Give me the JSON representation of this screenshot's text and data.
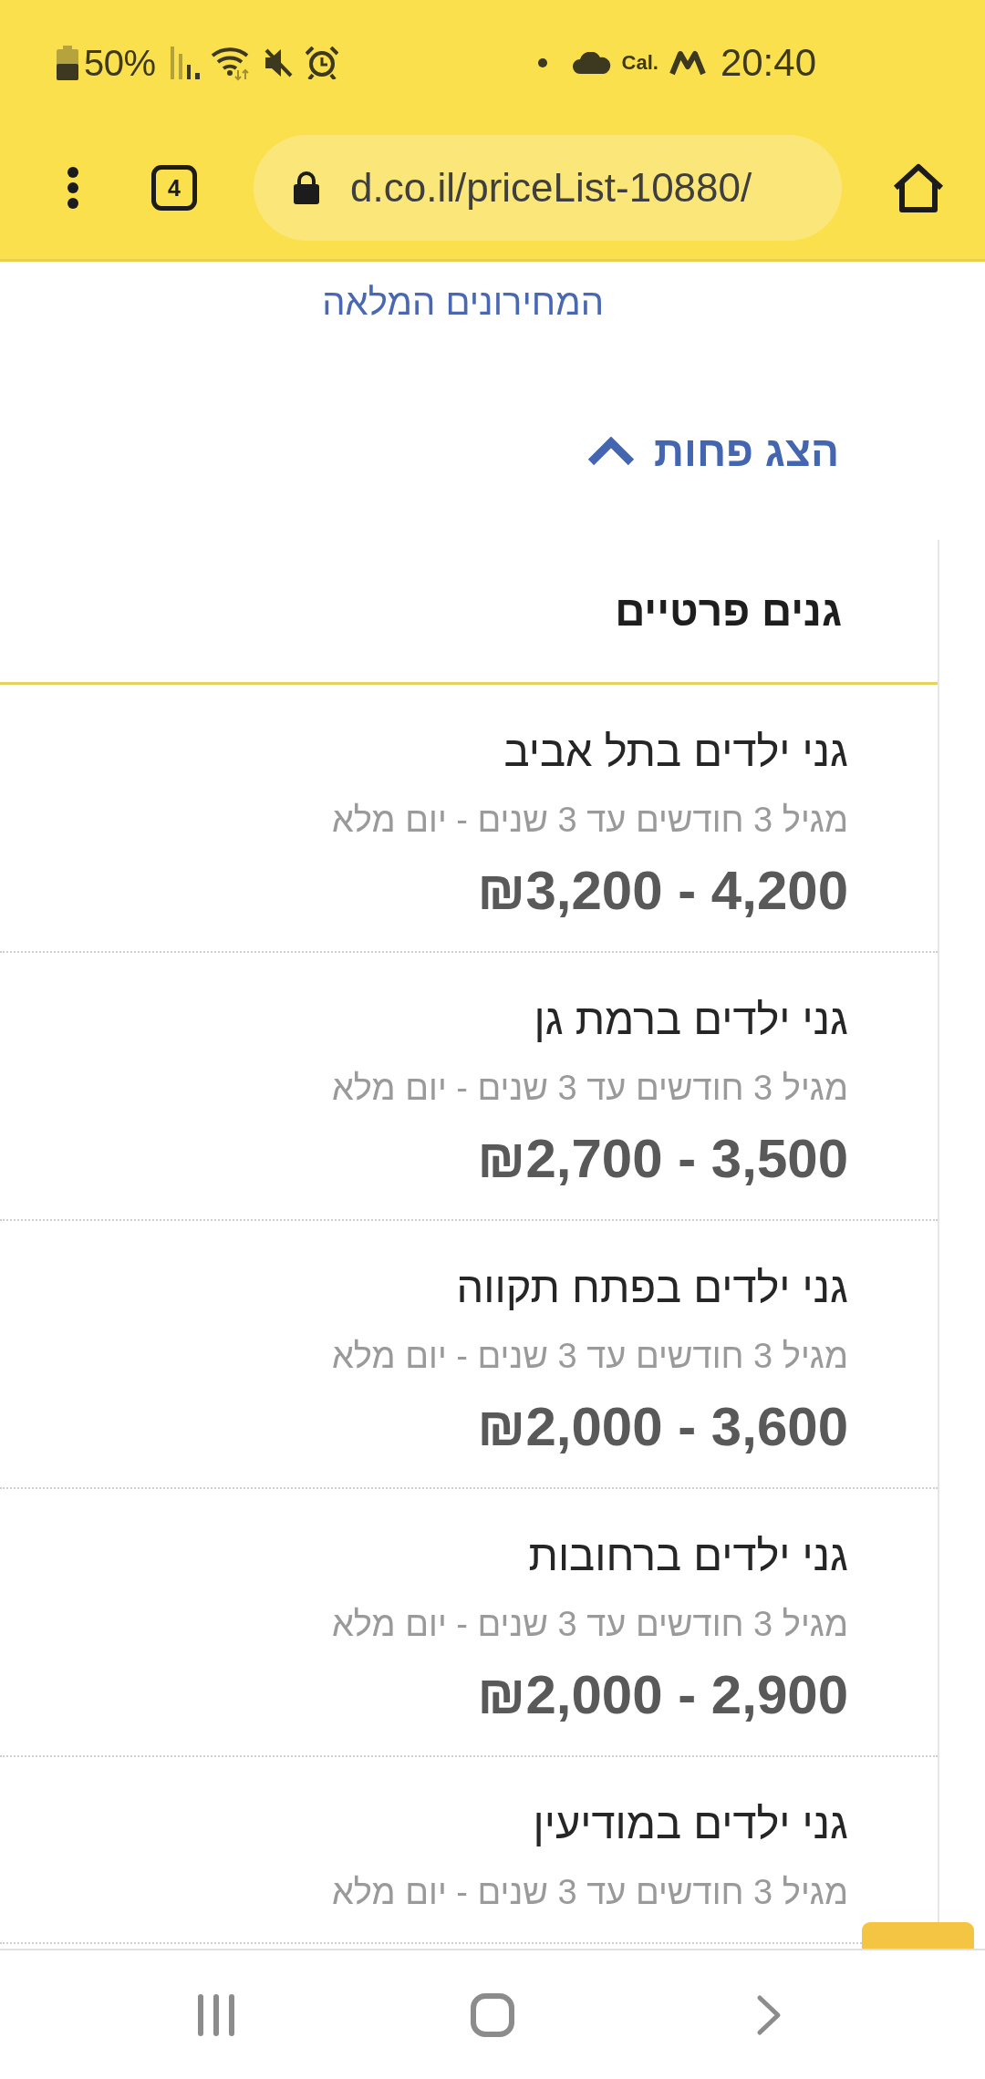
{
  "status_bar": {
    "battery": "50%",
    "notification_label": "Cal.",
    "time": "20:40"
  },
  "browser_toolbar": {
    "tab_count": "4",
    "url": "d.co.il/priceList-10880/"
  },
  "page": {
    "link": "המחירונים המלאה",
    "toggle": {
      "label": "הצג פחות",
      "expanded": true
    }
  },
  "price_table": {
    "title": "גנים פרטיים",
    "rows": [
      {
        "name": "גני ילדים בתל אביב",
        "detail": "מגיל 3 חודשים עד 3 שנים - יום מלא",
        "price": "₪3,200 - 4,200"
      },
      {
        "name": "גני ילדים ברמת גן",
        "detail": "מגיל 3 חודשים עד 3 שנים - יום מלא",
        "price": "₪2,700 - 3,500"
      },
      {
        "name": "גני ילדים בפתח תקווה",
        "detail": "מגיל 3 חודשים עד 3 שנים - יום מלא",
        "price": "₪2,000 - 3,600"
      },
      {
        "name": "גני ילדים ברחובות",
        "detail": "מגיל 3 חודשים עד 3 שנים - יום מלא",
        "price": "₪2,000 - 2,900"
      },
      {
        "name": "גני ילדים במודיעין",
        "detail": "מגיל 3 חודשים עד 3 שנים - יום מלא"
      }
    ]
  }
}
